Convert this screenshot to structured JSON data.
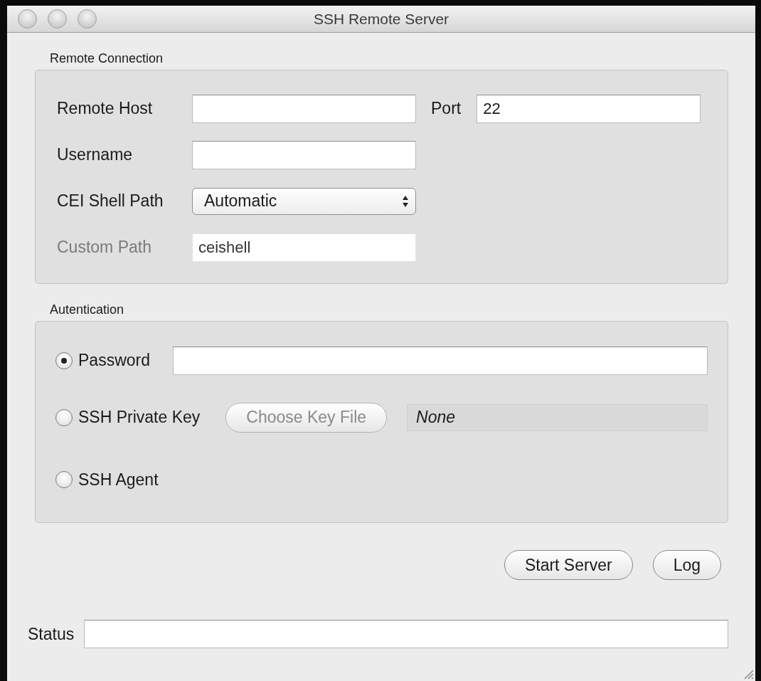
{
  "window": {
    "title": "SSH Remote Server"
  },
  "remote_connection": {
    "title": "Remote Connection",
    "host": {
      "label": "Remote Host"
    },
    "port": {
      "label": "Port",
      "value": "22"
    },
    "username": {
      "label": "Username"
    },
    "shell_path": {
      "label": "CEI Shell Path",
      "value": "Automatic"
    },
    "custom_path": {
      "label": "Custom Path",
      "value": "ceishell",
      "disabled": true
    }
  },
  "authentication": {
    "title": "Autentication",
    "options": [
      {
        "kind": "field",
        "label": "Password",
        "selected": true
      },
      {
        "kind": "file",
        "label": "SSH Private Key",
        "selected": false,
        "button": {
          "label": "Choose Key File",
          "disabled": true
        },
        "file": "None"
      },
      {
        "kind": "plain",
        "label": "SSH Agent",
        "selected": false
      }
    ]
  },
  "buttons": [
    "Start Server",
    "Log"
  ],
  "status": {
    "label": "Status"
  }
}
